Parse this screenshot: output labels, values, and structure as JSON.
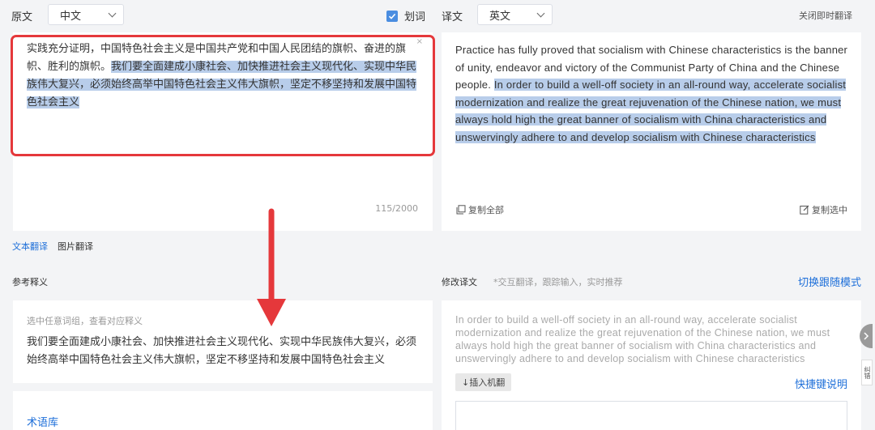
{
  "source": {
    "label": "原文",
    "lang": "中文",
    "highlight_toggle_label": "划词",
    "highlight_checked": true,
    "text_plain": "实践充分证明，中国特色社会主义是中国共产党和中国人民团结的旗帜、奋进的旗帜、胜利的旗帜。",
    "text_highlighted": "我们要全面建成小康社会、加快推进社会主义现代化、实现中华民族伟大复兴，必须始终高举中国特色社会主义伟大旗帜，坚定不移坚持和发展中国特色社会主义",
    "char_count": "115/2000",
    "clear_glyph": "×"
  },
  "target": {
    "label": "译文",
    "lang": "英文",
    "close_instant_label": "关闭即时翻译",
    "text_plain": "Practice has fully proved that socialism with Chinese characteristics is the banner of unity, endeavor and victory of the Communist Party of China and the Chinese people. ",
    "text_highlighted": "In order to build a well-off society in an all-round way, accelerate socialist modernization and realize the great rejuvenation of the Chinese nation, we must always hold high the great banner of socialism with China characteristics and unswervingly adhere to and develop socialism with Chinese characteristics",
    "copy_all_label": "复制全部",
    "copy_selected_label": "复制选中"
  },
  "mode_tabs": {
    "text_translate": "文本翻译",
    "image_translate": "图片翻译"
  },
  "reference": {
    "label": "参考释义",
    "hint": "选中任意词组，查看对应释义",
    "text": "我们要全面建成小康社会、加快推进社会主义现代化、实现中华民族伟大复兴，必须始终高举中国特色社会主义伟大旗帜，坚定不移坚持和发展中国特色社会主义",
    "term_bank": "术语库"
  },
  "edit": {
    "label": "修改译文",
    "hint": "*交互翻译，跟踪输入，实时推荐",
    "switch_mode": "切换跟随模式",
    "placeholder_text": "In order to build a well-off society in an all-round way, accelerate socialist modernization and realize the great rejuvenation of the Chinese nation, we must always hold high the great banner of socialism with China characteristics and unswervingly adhere to and develop socialism with Chinese characteristics",
    "insert_mt": "↓插入机翻",
    "shortcut_help": "快捷键说明"
  },
  "side_widget": {
    "label": "纠错"
  },
  "colors": {
    "accent_blue": "#1e6fd9",
    "highlight": "#b8cdea",
    "annotation_red": "#e5383b"
  }
}
